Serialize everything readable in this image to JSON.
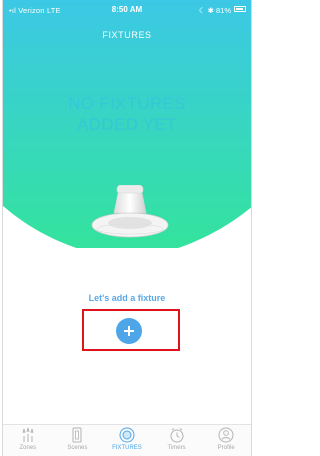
{
  "status_bar": {
    "carrier": "•ıl Verizon  LTE",
    "time": "8:50 AM",
    "right": "☾ ✱ 81%"
  },
  "nav": {
    "title": "FIXTURES"
  },
  "empty_state": {
    "line1": "NO FIXTURES",
    "line2": "ADDED YET",
    "prompt": "Let's add a fixture"
  },
  "add_button": {
    "icon": "plus-icon"
  },
  "tabs": [
    {
      "label": "Zones",
      "icon": "zones-icon",
      "active": false
    },
    {
      "label": "Scenes",
      "icon": "scenes-icon",
      "active": false
    },
    {
      "label": "FIXTURES",
      "icon": "fixtures-icon",
      "active": true
    },
    {
      "label": "Timers",
      "icon": "timer-icon",
      "active": false
    },
    {
      "label": "Profile",
      "icon": "profile-icon",
      "active": false
    }
  ],
  "colors": {
    "gradient_top": "#3cc7e4",
    "gradient_bottom": "#35e09a",
    "accent": "#4ea6e8",
    "highlight": "#e0131b"
  }
}
